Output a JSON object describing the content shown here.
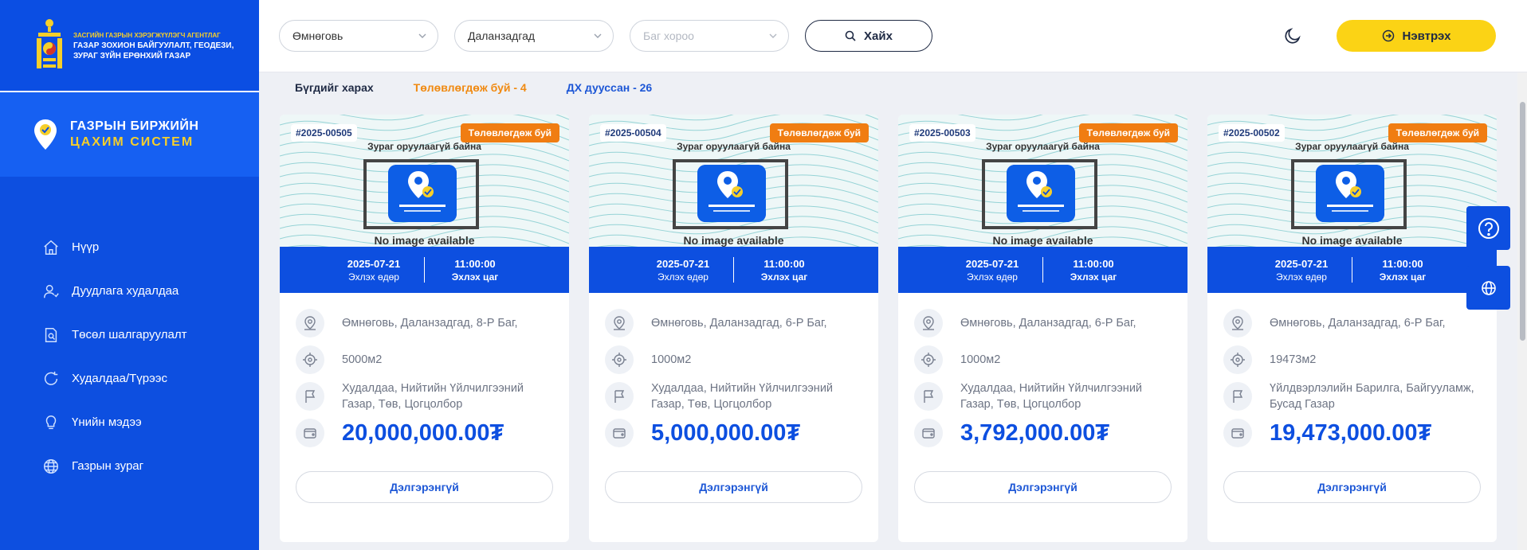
{
  "agency": {
    "line1": "ЗАСГИЙН ГАЗРЫН ХЭРЭГЖҮҮЛЭГЧ АГЕНТЛАГ",
    "line2": "ГАЗАР ЗОХИОН БАЙГУУЛАЛТ, ГЕОДЕЗИ,",
    "line3": "ЗУРАГ ЗҮЙН ЕРӨНХИЙ ГАЗАР"
  },
  "brand": {
    "line1": "ГАЗРЫН БИРЖИЙН",
    "line2": "ЦАХИМ СИСТЕМ"
  },
  "nav": [
    {
      "label": "Нүүр",
      "icon": "home-icon"
    },
    {
      "label": "Дуудлага худалдаа",
      "icon": "user-icon"
    },
    {
      "label": "Төсөл шалгаруулалт",
      "icon": "document-search-icon"
    },
    {
      "label": "Худалдаа/Түрээс",
      "icon": "refresh-icon"
    },
    {
      "label": "Үнийн мэдээ",
      "icon": "lightbulb-icon"
    },
    {
      "label": "Газрын зураг",
      "icon": "globe-icon"
    }
  ],
  "filters": {
    "province": "Өмнөговь",
    "district": "Даланзадгад",
    "khoroo_placeholder": "Баг хороо",
    "search_label": "Хайх",
    "login_label": "Нэвтрэх"
  },
  "tabs": {
    "all": "Бүгдийг харах",
    "planned": "Төлөвлөгдөж буй - 4",
    "finished": "ДХ дууссан - 26"
  },
  "image_placeholder": {
    "top": "Зураг оруулаагүй байна",
    "bottom": "No image available"
  },
  "date_labels": {
    "start_date": "Эхлэх өдөр",
    "start_time": "Эхлэх цаг"
  },
  "detail_label": "Дэлгэрэнгүй",
  "cards": [
    {
      "code": "#2025-00505",
      "status": "Төлөвлөгдөж буй",
      "date": "2025-07-21",
      "time": "11:00:00",
      "location": "Өмнөговь, Даланзадгад, 8-Р Баг,",
      "area": "5000м2",
      "purpose": "Худалдаа, Нийтийн Үйлчилгээний Газар, Төв, Цогцолбор",
      "price": "20,000,000.00₮"
    },
    {
      "code": "#2025-00504",
      "status": "Төлөвлөгдөж буй",
      "date": "2025-07-21",
      "time": "11:00:00",
      "location": "Өмнөговь, Даланзадгад, 6-Р Баг,",
      "area": "1000м2",
      "purpose": "Худалдаа, Нийтийн Үйлчилгээний Газар, Төв, Цогцолбор",
      "price": "5,000,000.00₮"
    },
    {
      "code": "#2025-00503",
      "status": "Төлөвлөгдөж буй",
      "date": "2025-07-21",
      "time": "11:00:00",
      "location": "Өмнөговь, Даланзадгад, 6-Р Баг,",
      "area": "1000м2",
      "purpose": "Худалдаа, Нийтийн Үйлчилгээний Газар, Төв, Цогцолбор",
      "price": "3,792,000.00₮"
    },
    {
      "code": "#2025-00502",
      "status": "Төлөвлөгдөж буй",
      "date": "2025-07-21",
      "time": "11:00:00",
      "location": "Өмнөговь, Даланзадгад, 6-Р Баг,",
      "area": "19473м2",
      "purpose": "Үйлдвэрлэлийн Барилга, Байгууламж, Бусад Газар",
      "price": "19,473,000.00₮"
    }
  ],
  "colors": {
    "primary": "#0d4fe0",
    "accent": "#fbd315",
    "status": "#f07d12"
  }
}
